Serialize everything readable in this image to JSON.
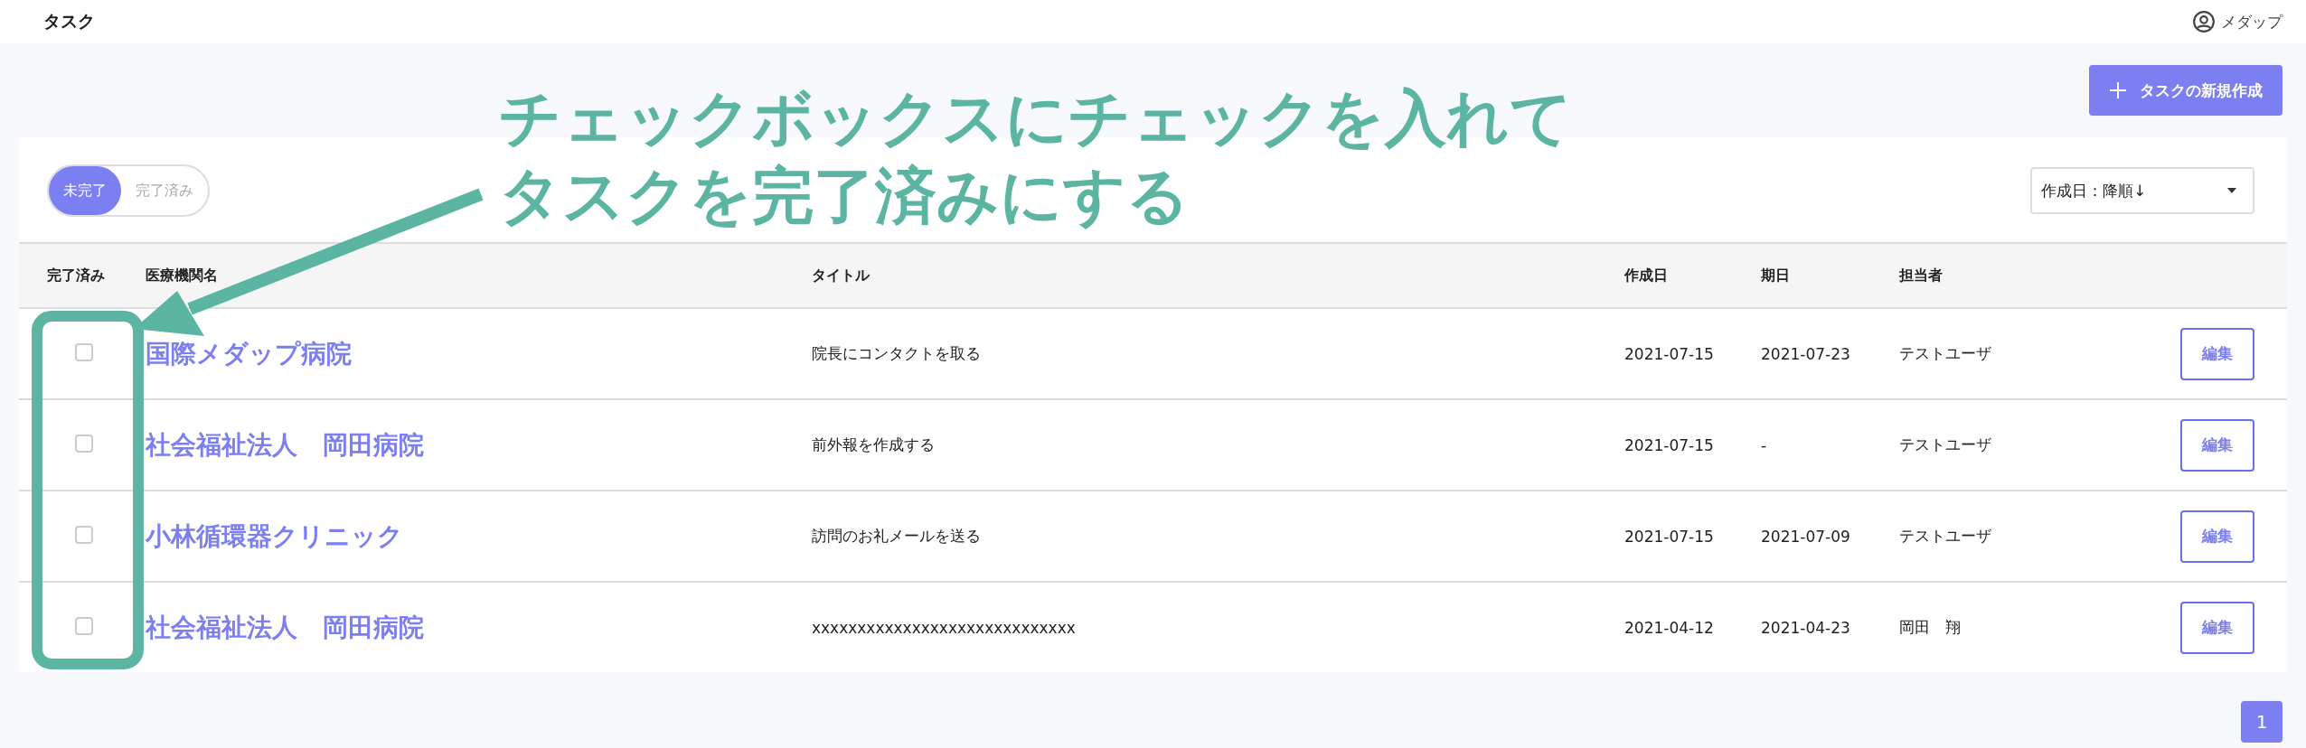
{
  "header": {
    "title": "タスク",
    "user": "メダップ"
  },
  "create_button": {
    "label": "タスクの新規作成"
  },
  "filter_tabs": [
    {
      "label": "未完了",
      "selected": true
    },
    {
      "label": "完了済み",
      "selected": false
    }
  ],
  "sort": {
    "value": "作成日：降順↓"
  },
  "table": {
    "columns": [
      "完了済み",
      "医療機関名",
      "タイトル",
      "作成日",
      "期日",
      "担当者"
    ],
    "rows": [
      {
        "checked": false,
        "facility": "国際メダップ病院",
        "title": "院長にコンタクトを取る",
        "created": "2021-07-15",
        "due": "2021-07-23",
        "assignee": "テストユーザ",
        "action": "編集"
      },
      {
        "checked": false,
        "facility": "社会福祉法人　岡田病院",
        "title": "前外報を作成する",
        "created": "2021-07-15",
        "due": "-",
        "assignee": "テストユーザ",
        "action": "編集"
      },
      {
        "checked": false,
        "facility": "小林循環器クリニック",
        "title": "訪問のお礼メールを送る",
        "created": "2021-07-15",
        "due": "2021-07-09",
        "assignee": "テストユーザ",
        "action": "編集"
      },
      {
        "checked": false,
        "facility": "社会福祉法人　岡田病院",
        "title": "xxxxxxxxxxxxxxxxxxxxxxxxxxxxx",
        "created": "2021-04-12",
        "due": "2021-04-23",
        "assignee": "岡田　翔",
        "action": "編集"
      }
    ]
  },
  "pagination": [
    {
      "label": "1",
      "selected": true
    }
  ],
  "annotation": {
    "lines": [
      "チェックボックスにチェックを入れて",
      "タスクを完了済みにする"
    ]
  }
}
